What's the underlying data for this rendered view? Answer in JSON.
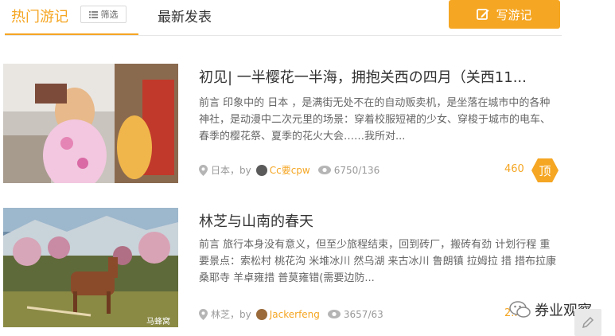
{
  "tabs": {
    "hot_label": "热门游记",
    "filter_label": "筛选",
    "latest_label": "最新发表",
    "write_label": "写游记"
  },
  "cards": [
    {
      "title": "初见| 一半樱花一半海，拥抱关西の四月（关西11...",
      "desc": "前言 印象中的 日本 ，是满街无处不在的自动贩卖机，是坐落在城市中的各种神社，是动漫中二次元里的场景：穿着校服短裙的少女、穿梭于城市的电车、春季的樱花祭、夏季的花火大会……我所对...",
      "place": "日本，by",
      "author": "Cc要cpw",
      "views": "6750/136",
      "likes": "460",
      "badge": "顶"
    },
    {
      "title": "林芝与山南的春天",
      "desc": "前言 旅行本身没有意义，但至少旅程结束，回到砖厂，搬砖有劲 计划行程 重要景点：索松村 桃花沟 米堆冰川 然乌湖 来古冰川 鲁朗镇 拉姆拉 措 措布拉康 桑耶寺 羊卓雍措 普莫雍错(需要边防...",
      "place": "林芝，by",
      "author": "Jackerfeng",
      "views": "3657/63",
      "likes": "2..."
    }
  ],
  "watermark": "券业观察",
  "thumb_watermark": "马蜂窝",
  "colors": {
    "accent": "#f5a623"
  }
}
